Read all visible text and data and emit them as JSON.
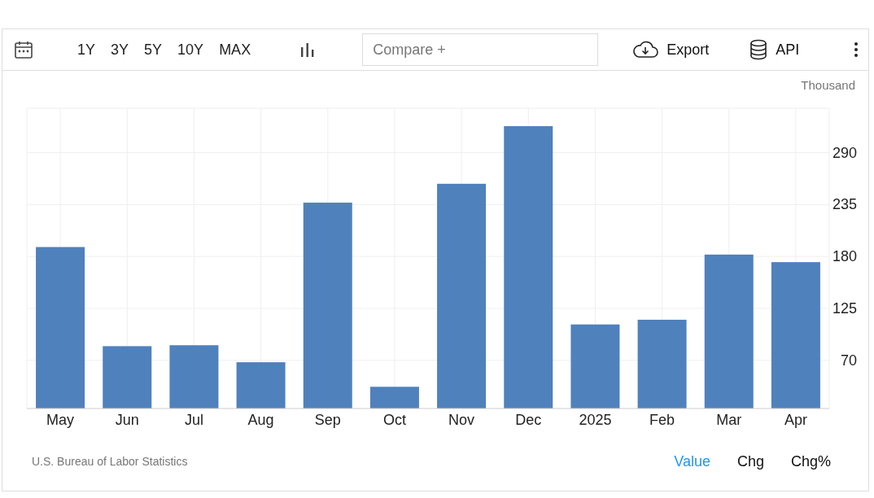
{
  "toolbar": {
    "periods": [
      "1Y",
      "3Y",
      "5Y",
      "10Y",
      "MAX"
    ],
    "compare": {
      "placeholder": "Compare +"
    },
    "export": "Export",
    "api": "API"
  },
  "chart": {
    "unit": "Thousand",
    "chart_data": {
      "type": "bar",
      "categories": [
        "May",
        "Jun",
        "Jul",
        "Aug",
        "Sep",
        "Oct",
        "Nov",
        "Dec",
        "2025",
        "Feb",
        "Mar",
        "Apr"
      ],
      "values": [
        190,
        85,
        86,
        68,
        237,
        42,
        257,
        318,
        108,
        113,
        182,
        174
      ],
      "grid": true,
      "ylim": [
        19,
        337
      ],
      "yticks": [
        70,
        125,
        180,
        235,
        290
      ]
    }
  },
  "footer": {
    "source": "U.S. Bureau of Labor Statistics",
    "views": [
      {
        "label": "Value",
        "selected": true
      },
      {
        "label": "Chg",
        "selected": false
      },
      {
        "label": "Chg%",
        "selected": false
      }
    ]
  }
}
